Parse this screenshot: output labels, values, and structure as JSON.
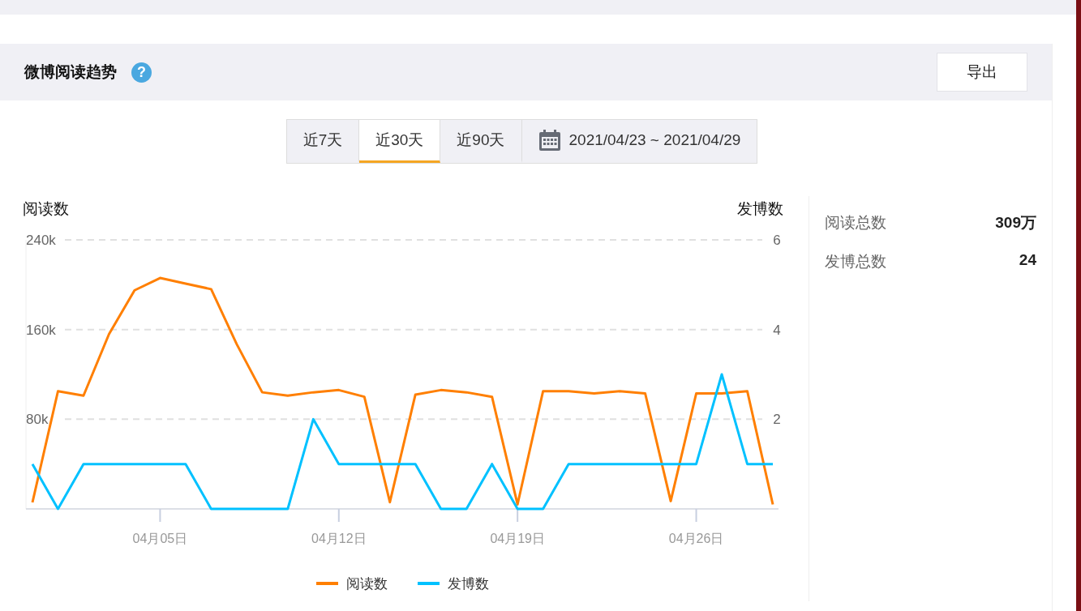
{
  "header": {
    "title": "微博阅读趋势",
    "help": "?",
    "export_button": "导出"
  },
  "ranges": [
    {
      "label": "近7天",
      "selected": false,
      "kind": "preset"
    },
    {
      "label": "近30天",
      "selected": true,
      "kind": "preset"
    },
    {
      "label": "近90天",
      "selected": false,
      "kind": "preset"
    },
    {
      "label": "2021/04/23 ~ 2021/04/29",
      "selected": false,
      "kind": "date"
    }
  ],
  "chart": {
    "chart_data": {
      "type": "line",
      "ylabel": "阅读数",
      "y2label": "发博数",
      "categories": [
        null,
        null,
        null,
        null,
        null,
        "04月05日",
        null,
        null,
        null,
        null,
        null,
        null,
        "04月12日",
        null,
        null,
        null,
        null,
        null,
        null,
        "04月19日",
        null,
        null,
        null,
        null,
        null,
        null,
        "04月26日",
        null,
        null,
        null
      ],
      "ylim": [
        0,
        240000
      ],
      "yticks": [
        {
          "value": 80000,
          "label": "80k"
        },
        {
          "value": 160000,
          "label": "160k"
        },
        {
          "value": 240000,
          "label": "240k"
        }
      ],
      "y2lim": [
        0,
        6
      ],
      "grid": true,
      "legend": "bottom",
      "y2ticks": [
        {
          "value": 2,
          "label": "2"
        },
        {
          "value": 4,
          "label": "4"
        },
        {
          "value": 6,
          "label": "6"
        }
      ],
      "series": [
        {
          "name": "阅读数",
          "color": "#ff7f00",
          "values": [
            5800,
            105000,
            101000,
            156000,
            195000,
            206000,
            201000,
            196000,
            147000,
            104000,
            101000,
            104000,
            106000,
            100000,
            6000,
            102000,
            106000,
            104000,
            100000,
            4000,
            105000,
            105000,
            103000,
            105000,
            103000,
            7000,
            103000,
            103000,
            105000,
            4000
          ]
        },
        {
          "name": "发博数",
          "color": "#00c1ff",
          "axis": "y2",
          "values": [
            1,
            0,
            1,
            1,
            1,
            1,
            1,
            0,
            0,
            0,
            0,
            2,
            1,
            1,
            1,
            1,
            0,
            0,
            1,
            0,
            0,
            1,
            1,
            1,
            1,
            1,
            1,
            3,
            1,
            1
          ]
        }
      ]
    }
  },
  "stats": [
    {
      "label": "阅读总数",
      "value": "309万"
    },
    {
      "label": "发博总数",
      "value": "24"
    }
  ]
}
